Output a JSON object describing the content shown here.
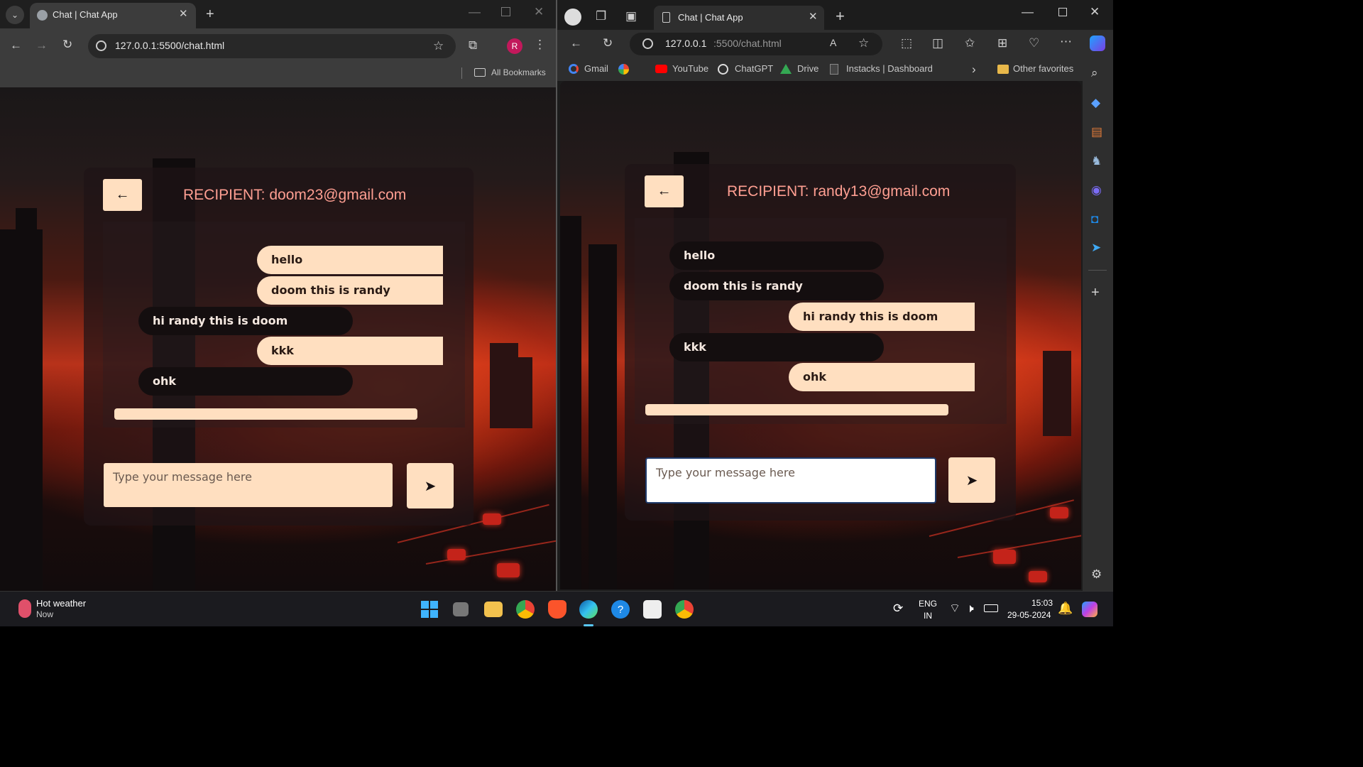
{
  "chrome": {
    "tab_title": "Chat | Chat App",
    "url": "127.0.0.1:5500/chat.html",
    "profile_initial": "R",
    "all_bookmarks": "All Bookmarks"
  },
  "edge": {
    "tab_title": "Chat | Chat App",
    "url_host": "127.0.0.1",
    "url_path": ":5500/chat.html",
    "bookmarks": [
      "Gmail",
      "YouTube",
      "ChatGPT",
      "Drive",
      "Instacks | Dashboard"
    ],
    "other_favorites": "Other favorites"
  },
  "chat_left": {
    "recipient": "RECIPIENT: doom23@gmail.com",
    "messages": [
      {
        "text": "hello",
        "from": "me"
      },
      {
        "text": "doom this is randy",
        "from": "me"
      },
      {
        "text": "hi randy this is doom",
        "from": "them"
      },
      {
        "text": "kkk",
        "from": "me"
      },
      {
        "text": "ohk",
        "from": "them"
      }
    ],
    "input_placeholder": "Type your message here"
  },
  "chat_right": {
    "recipient": "RECIPIENT: randy13@gmail.com",
    "messages": [
      {
        "text": "hello",
        "from": "them"
      },
      {
        "text": "doom this is randy",
        "from": "them"
      },
      {
        "text": "hi randy this is doom",
        "from": "me"
      },
      {
        "text": "kkk",
        "from": "them"
      },
      {
        "text": "ohk",
        "from": "me"
      }
    ],
    "input_placeholder": "Type your message here"
  },
  "taskbar": {
    "weather_title": "Hot weather",
    "weather_sub": "Now",
    "lang_line1": "ENG",
    "lang_line2": "IN",
    "time": "15:03",
    "date": "29-05-2024"
  },
  "colors": {
    "bubble_me": "#ffdfc0",
    "bubble_them": "#140e0f",
    "recipient_text": "#ff9f92"
  }
}
